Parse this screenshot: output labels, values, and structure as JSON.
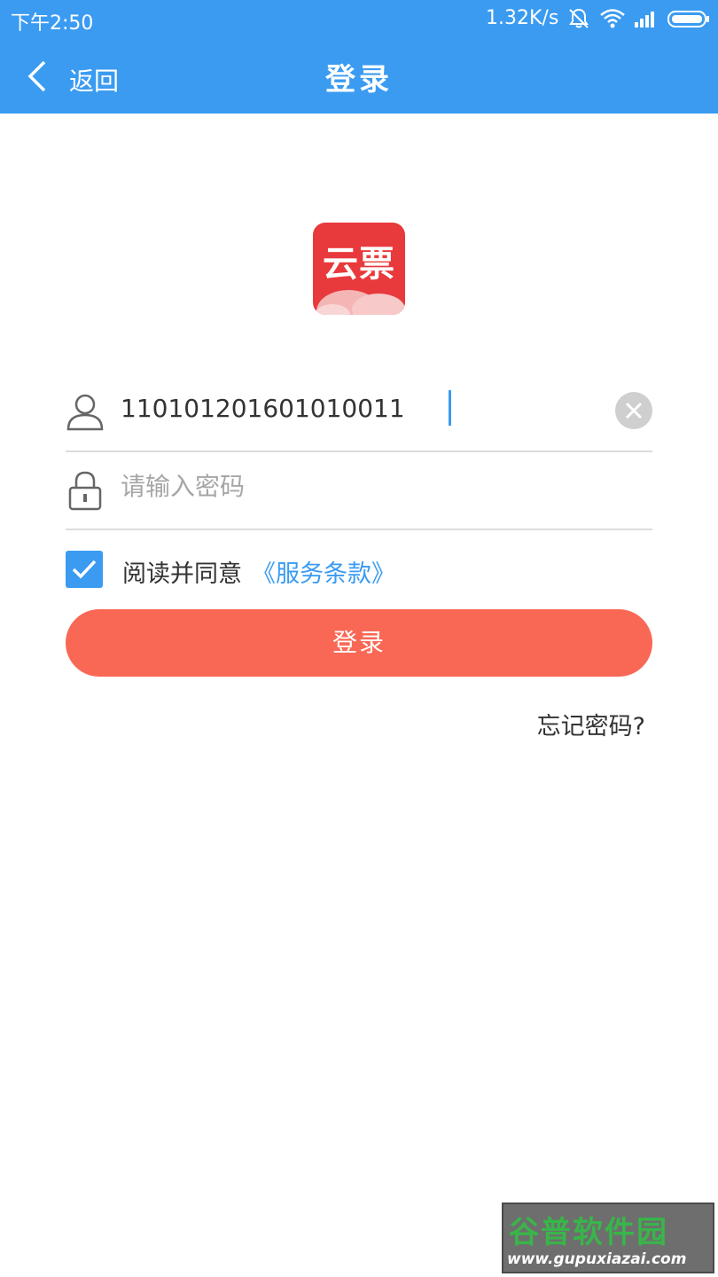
{
  "status_bar": {
    "time": "下午2:50",
    "network_speed": "1.32K/s",
    "icons": [
      "notification-muted-icon",
      "wifi-icon",
      "signal-icon",
      "battery-icon"
    ]
  },
  "nav": {
    "back_label": "返回",
    "title": "登录"
  },
  "logo": {
    "text": "云票"
  },
  "form": {
    "account_value": "110101201601010011",
    "password_placeholder": "请输入密码",
    "agree_text": "阅读并同意",
    "terms_link": "《服务条款》",
    "agree_checked": true,
    "login_button": "登录",
    "forgot_password": "忘记密码?"
  },
  "watermark": {
    "title": "谷普软件园",
    "url": "www.gupuxiazai.com"
  },
  "colors": {
    "primary_blue": "#3a9bf1",
    "login_button": "#f96855",
    "logo_red": "#e8393c"
  }
}
